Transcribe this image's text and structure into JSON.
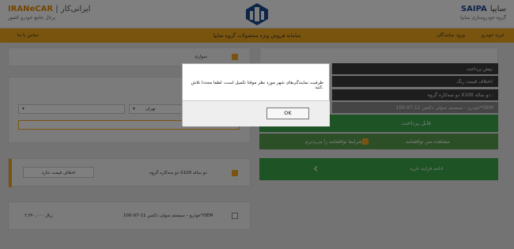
{
  "header": {
    "brand_right_name": "سایپا",
    "brand_right_logo": "SAIPA",
    "brand_right_tag": "گروه خودروسازی سایپا",
    "brand_left_name": "ایرانی‌کار",
    "brand_left_logo": "IRANeCAR",
    "brand_left_tag": "پرتال جامع خودرو کشور"
  },
  "nav": {
    "buy": "خرید خودرو",
    "login": "ورود نمایندگان",
    "title": "سامانه فروش ویژه محصولات گروه سایپا",
    "contact": "تماس با ما"
  },
  "left_panel": {
    "color_label": "سواری",
    "city": "تهران",
    "product_row": "دو سه‌کاره گروه X100 دو ساله",
    "price_diff_button": "اختلاف قیمت ندارد",
    "car_desc": "خودرو – سیستم سولی دکتس 11-97-100*OEM",
    "price": "۲,۳۷۰,۰۰۰ ریال"
  },
  "right_panel": {
    "pre_payment": "پیش پرداخت:",
    "price_difference": "اختلاف قیمت رنگ:",
    "product_title": "دو سه‌کاره گروه X100 دو ساله :",
    "product_sub": "خودرو – سیستم سولی دکتس 11-97-100*OEM",
    "payable": "قابل پرداخت",
    "view_contract": "مشاهده متن توافقنامه",
    "accept_terms": "شرایط توافقنامه را می‌پذیرم.",
    "continue": "ادامه فرایند خرید"
  },
  "dialog": {
    "message": "ظرفیت نمایندگی‌های شهر مورد نظر موقتا تکمیل است، لطفا مجددا تلاش کنید.",
    "ok": "OK"
  }
}
